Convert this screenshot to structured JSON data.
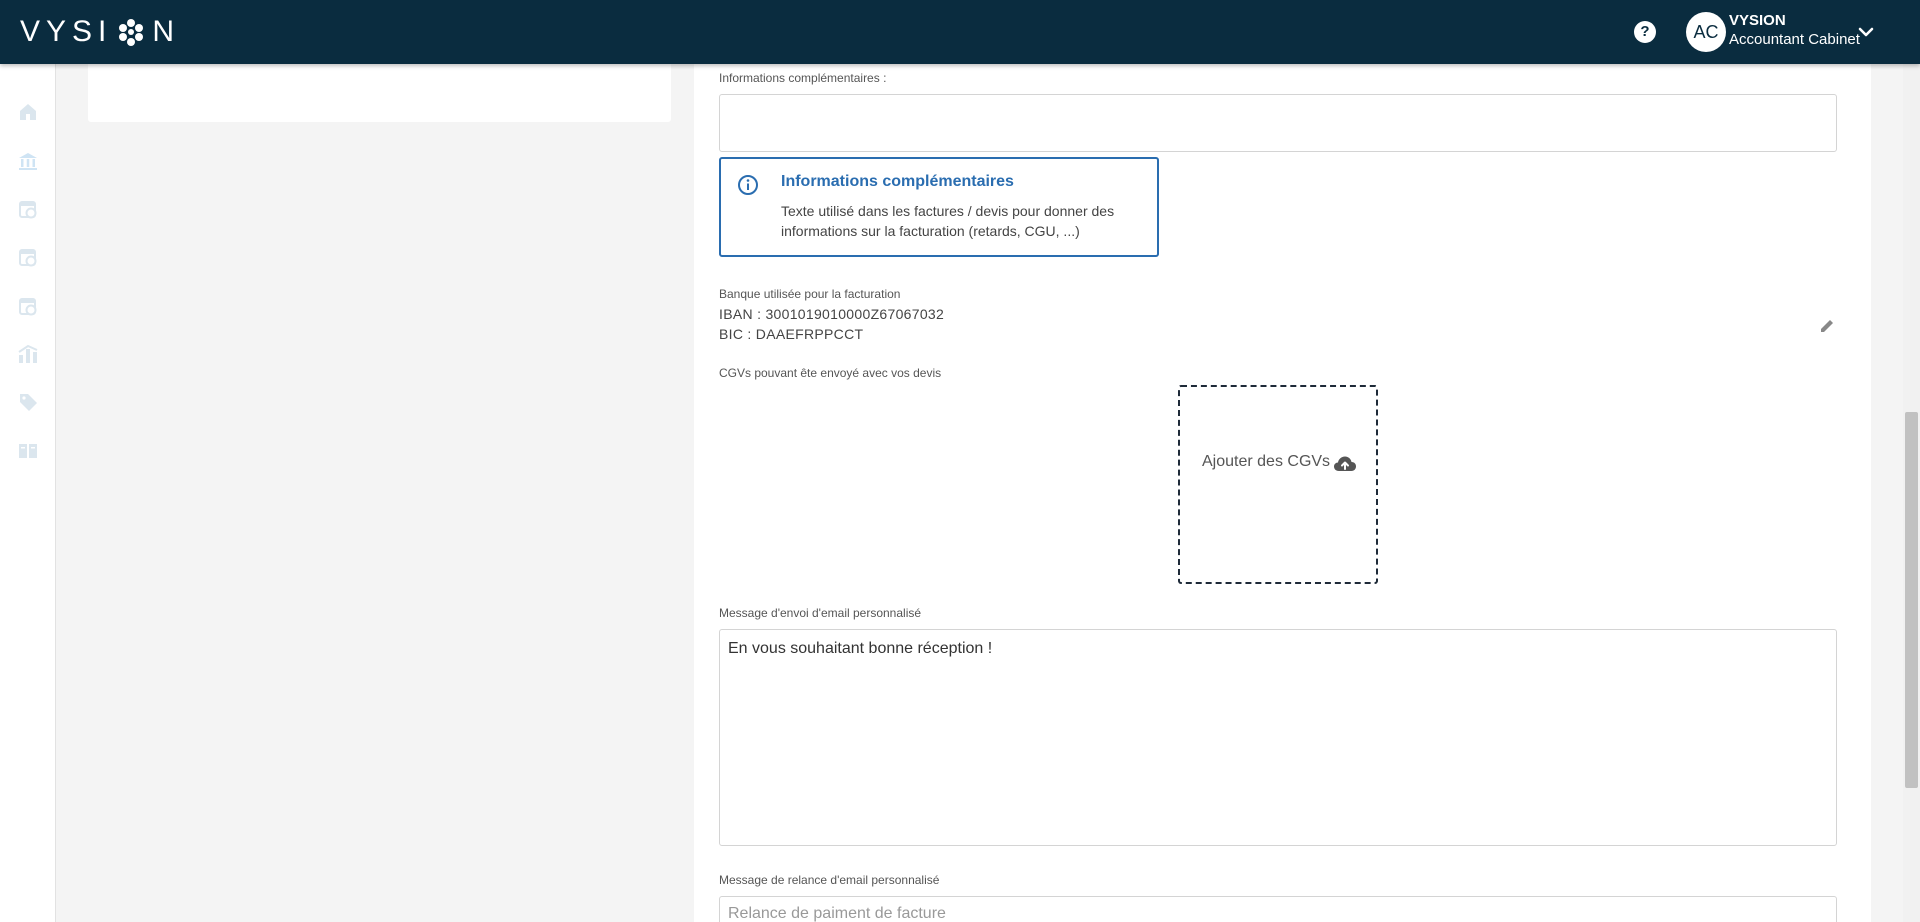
{
  "header": {
    "logo_text_left": "VYSI",
    "logo_text_right": "N",
    "help_icon": "help-circle-icon",
    "avatar_initials": "AC",
    "user_name": "VYSION",
    "user_role": "Accountant Cabinet",
    "menu_icon": "chevron-down-icon"
  },
  "sidebar": {
    "items": [
      {
        "icon": "home-icon"
      },
      {
        "icon": "bank-icon"
      },
      {
        "icon": "calendar-doc-icon"
      },
      {
        "icon": "calendar-doc-icon"
      },
      {
        "icon": "calendar-doc-icon"
      },
      {
        "icon": "chart-icon"
      },
      {
        "icon": "tag-icon"
      },
      {
        "icon": "book-icon"
      }
    ]
  },
  "form": {
    "additional_info_label": "Informations complémentaires :",
    "additional_info_value": "",
    "info_box": {
      "title": "Informations complémentaires",
      "text": "Texte utilisé dans les factures / devis pour donner des informations sur la facturation (retards, CGU, ...)"
    },
    "bank": {
      "label": "Banque utilisée pour la facturation",
      "iban": "IBAN : 3001019010000Z67067032",
      "bic": "BIC : DAAEFRPPCCT"
    },
    "cgv": {
      "label": "CGVs pouvant ête envoyé avec vos devis",
      "upload_label": "Ajouter des CGVs"
    },
    "email_message": {
      "label": "Message d'envoi d'email personnalisé",
      "value": "En vous souhaitant bonne réception !"
    },
    "reminder_message": {
      "label": "Message de relance d'email personnalisé",
      "placeholder": "Relance de paiment de facture"
    }
  },
  "colors": {
    "topbar": "#0a2c3f",
    "accent": "#2a6db0",
    "sidebar_icons": "#dbe6ee",
    "sidebar_active": "#cfe4f4"
  }
}
